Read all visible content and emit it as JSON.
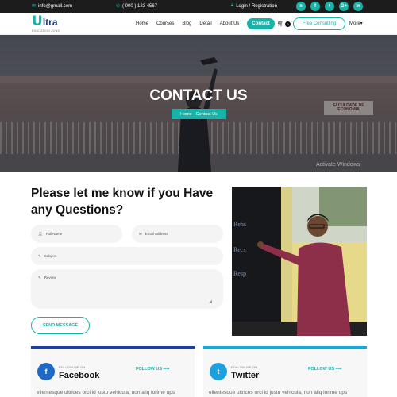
{
  "topbar": {
    "email": "info@gmail.com",
    "phone": "( 000 ) 123 4567",
    "login": "Login / Registration",
    "socials": [
      "rss-icon",
      "facebook-icon",
      "twitter-icon",
      "google-plus-icon",
      "linkedin-icon"
    ],
    "social_glyphs": [
      "ʀ",
      "f",
      "t",
      "G+",
      "in"
    ]
  },
  "brand": {
    "letter": "U",
    "rest": "ltra",
    "tagline": "EDUCATION ZONE"
  },
  "nav": {
    "items": [
      "Home",
      "Courses",
      "Blog",
      "Detail",
      "About Us"
    ],
    "active": "Contact",
    "cart_count": "0",
    "cta": "Free Consulting",
    "more": "More"
  },
  "hero": {
    "title": "CONTACT US",
    "breadcrumb": "Home - Contact Us",
    "sign_text": "FACULDADE DE ECONOMIA",
    "watermark": "Activate Windows"
  },
  "form": {
    "heading": "Please let me know if you Have any Questions?",
    "name_placeholder": "Full Name",
    "email_placeholder": "Email Address",
    "subject_placeholder": "Subject",
    "review_placeholder": "Review",
    "submit": "SEND MESSAGE"
  },
  "cards": [
    {
      "label": "FOLLOW ME ON",
      "name": "Facebook",
      "link": "FOLLOW US",
      "desc": "ellentesque ultrices orci id justo vehicula, non aliq lorime ups",
      "accent": "#1e3f9a",
      "icon_bg": "#1e69c6"
    },
    {
      "label": "FOLLOW ME ON",
      "name": "Twitter",
      "link": "FOLLOW US",
      "desc": "ellentesque ultrices orci id justo vehicula, non aliq lorime ups",
      "accent": "#19a8d6",
      "icon_bg": "#1ba0e0"
    }
  ],
  "colors": {
    "accent": "#15b3a8",
    "dark": "#1c1c1c"
  }
}
